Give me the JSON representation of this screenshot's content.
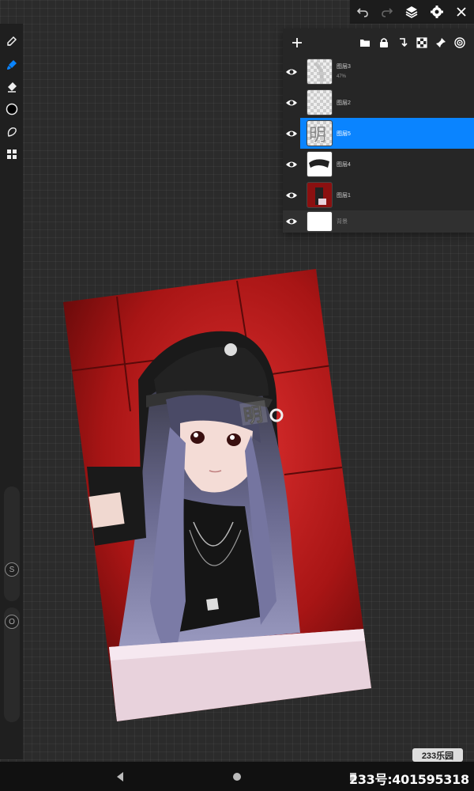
{
  "top_bar": {
    "icons": [
      "undo-icon",
      "redo-icon",
      "layers-icon",
      "settings-icon",
      "close-icon"
    ]
  },
  "toolbar": {
    "tools": [
      "pen-tool-icon",
      "brush-tool-icon",
      "eraser-tool-icon",
      "color-picker-icon",
      "lasso-tool-icon",
      "transform-grid-icon"
    ],
    "active_tool": "brush-tool-icon",
    "size_label": "S",
    "opacity_label": "O",
    "accent_color": "#0a84ff"
  },
  "layers_panel": {
    "header_icons": [
      "add-layer-icon",
      "folder-icon",
      "lock-icon",
      "merge-down-icon",
      "checker-icon",
      "pin-icon",
      "target-icon"
    ],
    "layers": [
      {
        "name": "图层3",
        "sub": "47%",
        "selected": false
      },
      {
        "name": "图层2",
        "sub": "",
        "selected": false
      },
      {
        "name": "图层5",
        "sub": "",
        "selected": true
      },
      {
        "name": "图层4",
        "sub": "",
        "selected": false
      },
      {
        "name": "图层1",
        "sub": "",
        "selected": false
      },
      {
        "name": "背景",
        "sub": "",
        "selected": false
      }
    ]
  },
  "canvas": {
    "sticker_text": "明"
  },
  "nav_bar": {
    "icons": [
      "back-icon",
      "home-icon",
      "recents-icon"
    ]
  },
  "watermark": {
    "id_text": "233号:401595318",
    "logo_text": "233乐园"
  }
}
